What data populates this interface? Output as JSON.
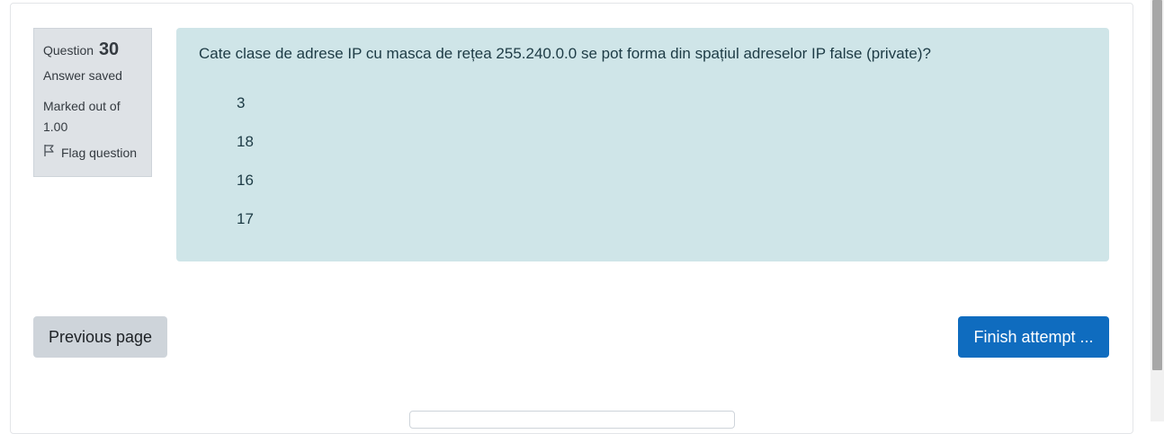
{
  "question_info": {
    "label": "Question",
    "number": "30",
    "state": "Answer saved",
    "grade": "Marked out of 1.00",
    "flag_label": "Flag question"
  },
  "question": {
    "text": "Cate clase de adrese IP cu masca de rețea 255.240.0.0 se pot forma din spațiul adreselor IP false (private)?",
    "options": [
      "3",
      "18",
      "16",
      "17"
    ]
  },
  "navigation": {
    "previous_label": "Previous page",
    "finish_label": "Finish attempt ..."
  },
  "colors": {
    "accent": "#0f6cbf",
    "formulation_bg": "#cfe5e8",
    "info_bg": "#dee2e6"
  },
  "icons": {
    "flag": "flag-icon"
  }
}
